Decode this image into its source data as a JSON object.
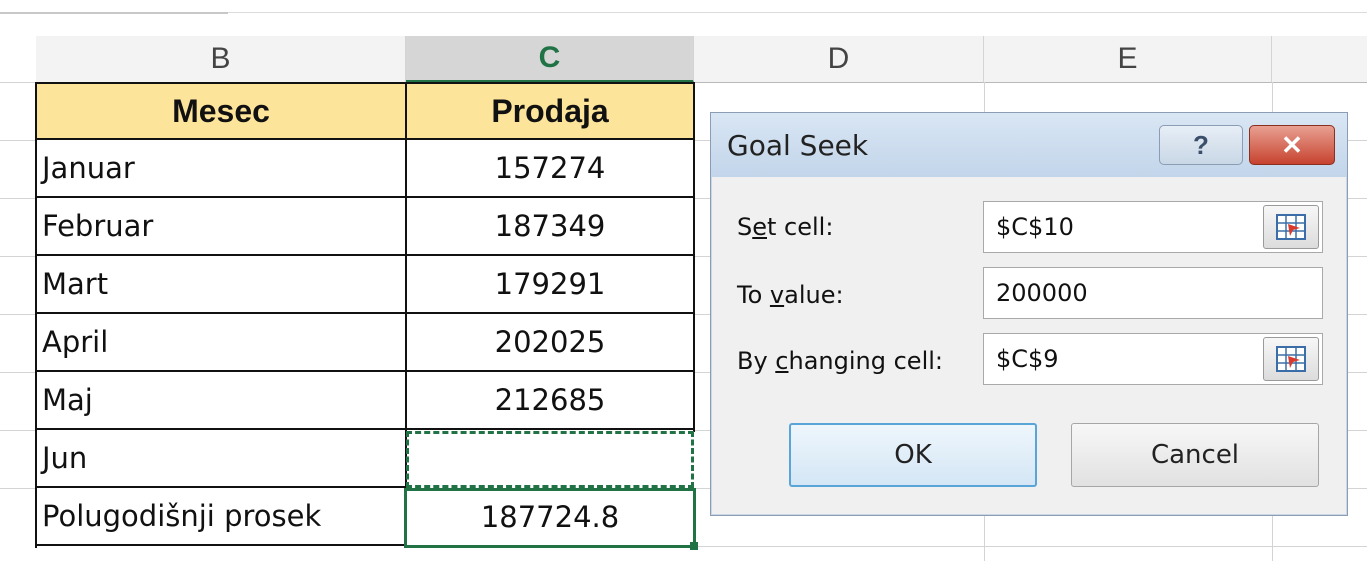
{
  "columns": [
    "B",
    "C",
    "D",
    "E"
  ],
  "table": {
    "header": {
      "month": "Mesec",
      "sales": "Prodaja"
    },
    "rows": [
      {
        "month": "Januar",
        "sales": "157274"
      },
      {
        "month": "Februar",
        "sales": "187349"
      },
      {
        "month": "Mart",
        "sales": "179291"
      },
      {
        "month": "April",
        "sales": "202025"
      },
      {
        "month": "Maj",
        "sales": "212685"
      },
      {
        "month": "Jun",
        "sales": ""
      },
      {
        "month": "Polugodišnji prosek",
        "sales": "187724.8"
      }
    ]
  },
  "dialog": {
    "title": "Goal Seek",
    "help_glyph": "?",
    "close_glyph": "✕",
    "set_cell": {
      "label_pre": "S",
      "label_key": "e",
      "label_post": "t cell:",
      "value": "$C$10"
    },
    "to_value": {
      "label_pre": "To ",
      "label_key": "v",
      "label_post": "alue:",
      "value": "200000"
    },
    "by_changing": {
      "label_pre": "By ",
      "label_key": "c",
      "label_post": "hanging cell:",
      "value": "$C$9"
    },
    "ok_label": "OK",
    "cancel_label": "Cancel"
  },
  "colors": {
    "header_fill": "#fde49b",
    "selected_column": "#217346",
    "dialog_title_bg": "#c2d5ea",
    "close_button": "#c7432f"
  }
}
